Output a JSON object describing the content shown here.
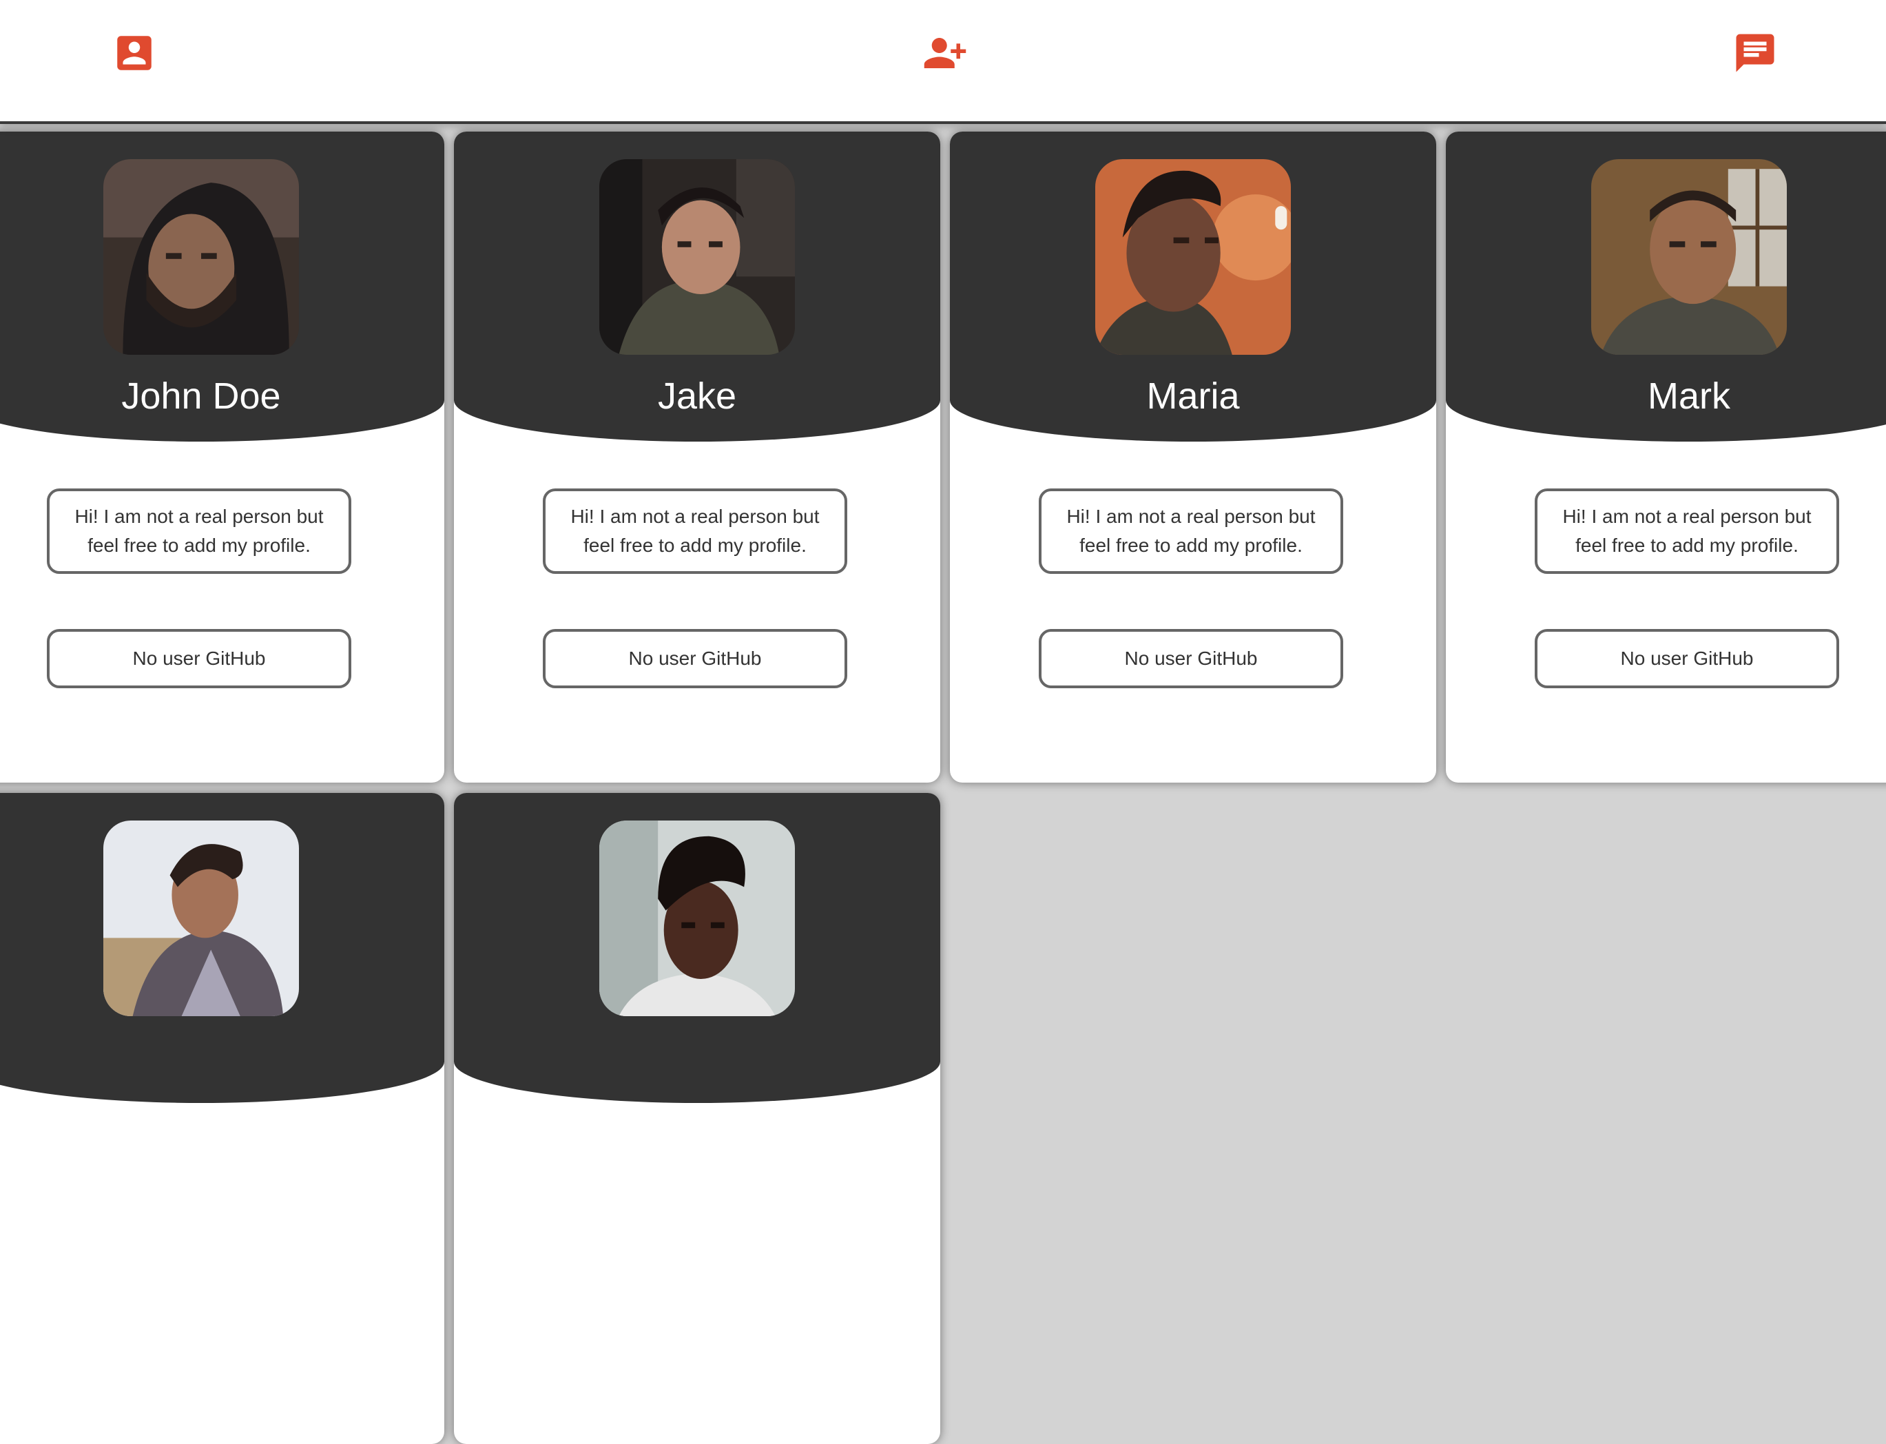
{
  "nav": {
    "profile_icon": "account-box-icon",
    "add_friend_icon": "person-add-icon",
    "chat_icon": "chat-message-icon",
    "accent_color": "#e04a2f"
  },
  "cards": [
    {
      "name": "John Doe",
      "bio": "Hi! I am not a real person but feel free to add my profile.",
      "github": "No user GitHub"
    },
    {
      "name": "Jake",
      "bio": "Hi! I am not a real person but feel free to add my profile.",
      "github": "No user GitHub"
    },
    {
      "name": "Maria",
      "bio": "Hi! I am not a real person but feel free to add my profile.",
      "github": "No user GitHub"
    },
    {
      "name": "Mark",
      "bio": "Hi! I am not a real person but feel free to add my profile.",
      "github": "No user GitHub"
    },
    {
      "name": "",
      "bio": "",
      "github": ""
    },
    {
      "name": "",
      "bio": "",
      "github": ""
    }
  ]
}
